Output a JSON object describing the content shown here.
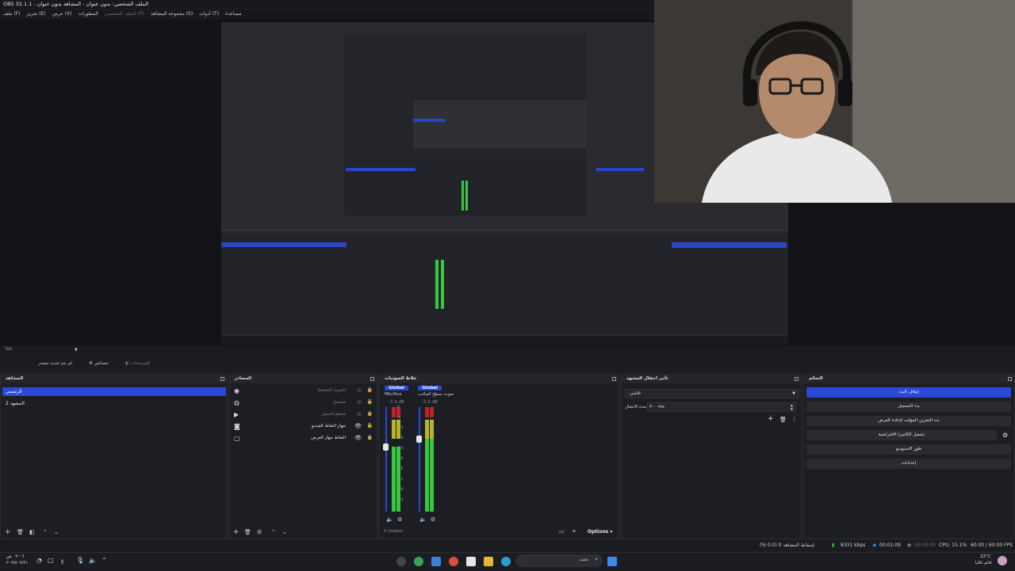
{
  "window": {
    "title": "OBS 32.1.1 - الملف الشخصي: بدون عنوان - المشاهد بدون عنوان"
  },
  "menu": {
    "items": [
      {
        "label": "ملف (F)",
        "enabled": true
      },
      {
        "label": "تحرير (E)",
        "enabled": true
      },
      {
        "label": "عرض (V)",
        "enabled": true
      },
      {
        "label": "المطورات",
        "enabled": true
      },
      {
        "label": "الملف الشخصي (P)",
        "enabled": false
      },
      {
        "label": "مجموعة المشاهد (S)",
        "enabled": true
      },
      {
        "label": "أدوات (T)",
        "enabled": true
      },
      {
        "label": "مساعدة",
        "enabled": true
      }
    ]
  },
  "toolbar_strip": {
    "left_label": "Talk"
  },
  "context_bar": {
    "no_source": "لم يتم تحديد مصدر",
    "properties": "خصائص",
    "filters": "المرشحات"
  },
  "scenes": {
    "title": "المشاهد",
    "items": [
      {
        "label": "الرئيسي",
        "active": true
      },
      {
        "label": "المشهد 2",
        "active": false
      }
    ]
  },
  "sources": {
    "title": "المصادر",
    "items": [
      {
        "icon": "audio-icon",
        "label": "الصوت الملتقط",
        "visible_icon": false,
        "dim": true
      },
      {
        "icon": "browser-icon",
        "label": "متصفح",
        "visible_icon": false,
        "dim": true
      },
      {
        "icon": "media-icon",
        "label": "مقطع الحميل",
        "visible_icon": false,
        "dim": true
      },
      {
        "icon": "camera-icon",
        "label": "جهاز التقاط الفيديو",
        "visible_icon": true,
        "dim": false
      },
      {
        "icon": "display-icon",
        "label": "التقاط جهاز العرض",
        "visible_icon": true,
        "dim": false
      }
    ]
  },
  "mixer": {
    "title": "خلاط الصوتيات",
    "channels": [
      {
        "badge": "Global",
        "name": "Mic/Aux",
        "db": "-7.3 dB",
        "level": 0.62
      },
      {
        "badge": "Global",
        "name": "صوت سطح المكتب",
        "db": "-3.2 dB",
        "level": 0.7
      }
    ],
    "scale": [
      "0",
      "-6",
      "-12",
      "-18",
      "-24",
      "-30",
      "-36",
      "-42",
      "-48",
      "-54"
    ],
    "hidden": "0 hidden",
    "options": "Options"
  },
  "transitions": {
    "title": "تأثير انتقال المشهد",
    "selected": "تلاشي",
    "duration_label": "مدة الانتقال",
    "duration_value": "٣٠٠ ms"
  },
  "controls": {
    "title": "التحكم",
    "buttons": [
      {
        "label": "إيقاف البث",
        "active": true
      },
      {
        "label": "بدء التسجيل",
        "active": false
      },
      {
        "label": "بدء التخزين المؤقت لإعادة العرض",
        "active": false
      },
      {
        "label": "تشغيل الكاميرا الافتراضية",
        "active": false
      },
      {
        "label": "طور الاستوديو",
        "active": false
      },
      {
        "label": "إعدادات",
        "active": false
      }
    ]
  },
  "status": {
    "dropped": "إسقاط المشاهد 0 (0.0 %)",
    "bitrate": "8331 kbps",
    "stream_time": "00:01:09",
    "rec_time": "00:00:00",
    "cpu": "CPU: 15.1%",
    "fps": "60.00 / 60.00 FPS"
  },
  "taskbar": {
    "search": "بحث",
    "time": "٠٢:٠٦ ص",
    "date": "٢٠٢٥/٠٩/٢١",
    "weather_temp": "22°C",
    "weather_desc": "غائم غالبا",
    "lang": "ع"
  }
}
